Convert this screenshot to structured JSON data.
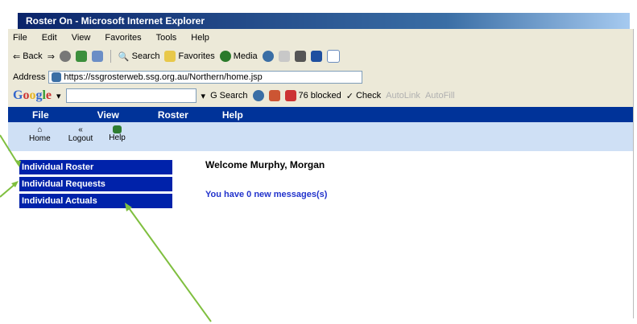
{
  "window": {
    "title": "Roster On - Microsoft Internet Explorer"
  },
  "menubar": {
    "items": [
      "File",
      "Edit",
      "View",
      "Favorites",
      "Tools",
      "Help"
    ]
  },
  "toolbar": {
    "back_label": "Back",
    "search_label": "Search",
    "favorites_label": "Favorites",
    "media_label": "Media"
  },
  "addressbar": {
    "label": "Address",
    "url": "https://ssgrosterweb.ssg.org.au/Northern/home.jsp"
  },
  "googlebar": {
    "logo": "Google",
    "search_label": "Search",
    "blocked_label": "76 blocked",
    "check_label": "Check",
    "autolink_label": "AutoLink",
    "autofill_label": "AutoFill"
  },
  "appnav": {
    "items": [
      "File",
      "View",
      "Roster",
      "Help"
    ]
  },
  "apptools": {
    "home_label": "Home",
    "logout_label": "Logout",
    "help_label": "Help"
  },
  "sidebar": {
    "items": [
      "Individual Roster",
      "Individual Requests",
      "Individual Actuals"
    ]
  },
  "main": {
    "welcome": "Welcome Murphy, Morgan",
    "messages": "You have 0 new messages(s)"
  },
  "colors": {
    "app_nav": "#003399",
    "sidebar_button": "#0022aa",
    "arrow": "#7fbf3f",
    "message_text": "#2233cc"
  }
}
